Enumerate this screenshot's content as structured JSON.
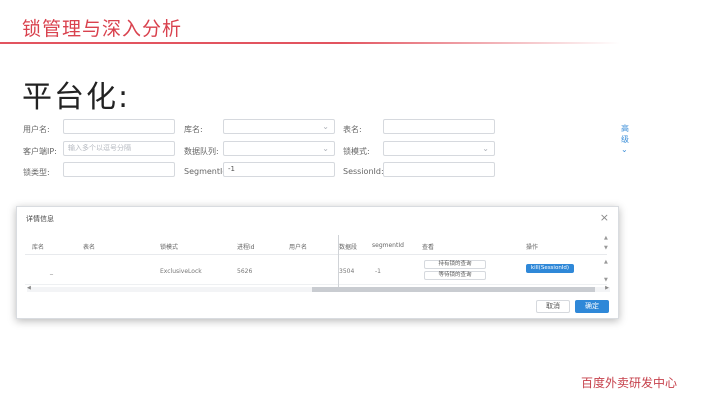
{
  "slide": {
    "title": "锁管理与深入分析",
    "subtitle": "平台化:",
    "footer": "百度外卖研发中心"
  },
  "filters": {
    "user_label": "用户名:",
    "db_label": "库名:",
    "table_label": "表名:",
    "client_ip_label": "客户端IP:",
    "client_ip_placeholder": "输入多个以逗号分隔",
    "queue_label": "数据队列:",
    "lock_mode_label": "锁模式:",
    "lock_type_label": "锁类型:",
    "segment_label": "SegmentId:",
    "segment_value": "-1",
    "session_label": "SessionId:",
    "advanced_label": "高级"
  },
  "dialog": {
    "title": "详情信息",
    "columns": [
      "库名",
      "表名",
      "锁模式",
      "进程id",
      "用户名",
      "数据段",
      "segmentId",
      "查看",
      "操作"
    ],
    "row": {
      "c1": "_",
      "c3": "ExclusiveLock",
      "c4": "5626",
      "c6": "3504",
      "c7": "-1"
    },
    "view_buttons": [
      "持有锁的查询",
      "等待锁的查询"
    ],
    "action": "kill(SessionId)",
    "cancel_label": "取消",
    "ok_label": "确定"
  },
  "colors": {
    "accent_red": "#d9424e",
    "primary_blue": "#2f88d8"
  }
}
